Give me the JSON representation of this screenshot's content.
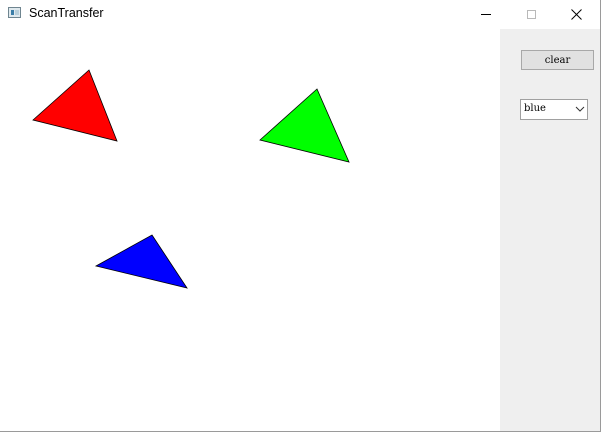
{
  "window": {
    "title": "ScanTransfer",
    "icon": "app-window-icon",
    "controls": [
      "minimize-icon",
      "maximize-icon",
      "close-icon"
    ]
  },
  "canvas": {
    "background": "#ffffff",
    "triangles": [
      {
        "color": "#ff0000",
        "name": "red-triangle"
      },
      {
        "color": "#00ff00",
        "name": "green-triangle"
      },
      {
        "color": "#0000ff",
        "name": "blue-triangle"
      }
    ]
  },
  "sidepanel": {
    "clear_label": "clear",
    "color_select": {
      "value": "blue",
      "icon": "chevron-down-icon"
    }
  }
}
